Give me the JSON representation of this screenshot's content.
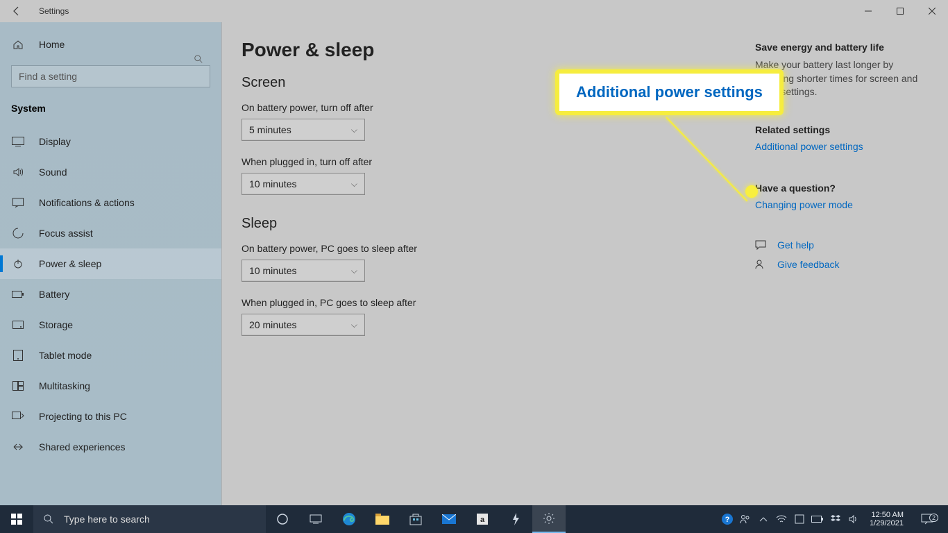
{
  "window": {
    "title": "Settings"
  },
  "sidebar": {
    "home": "Home",
    "search_placeholder": "Find a setting",
    "section": "System",
    "items": [
      {
        "label": "Display"
      },
      {
        "label": "Sound"
      },
      {
        "label": "Notifications & actions"
      },
      {
        "label": "Focus assist"
      },
      {
        "label": "Power & sleep"
      },
      {
        "label": "Battery"
      },
      {
        "label": "Storage"
      },
      {
        "label": "Tablet mode"
      },
      {
        "label": "Multitasking"
      },
      {
        "label": "Projecting to this PC"
      },
      {
        "label": "Shared experiences"
      }
    ]
  },
  "main": {
    "title": "Power & sleep",
    "sections": {
      "screen": {
        "heading": "Screen",
        "battery_label": "On battery power, turn off after",
        "battery_value": "5 minutes",
        "plugged_label": "When plugged in, turn off after",
        "plugged_value": "10 minutes"
      },
      "sleep": {
        "heading": "Sleep",
        "battery_label": "On battery power, PC goes to sleep after",
        "battery_value": "10 minutes",
        "plugged_label": "When plugged in, PC goes to sleep after",
        "plugged_value": "20 minutes"
      }
    }
  },
  "callout": {
    "text": "Additional power settings"
  },
  "aside": {
    "energy_head": "Save energy and battery life",
    "energy_text": "Make your battery last longer by choosing shorter times for screen and sleep settings.",
    "related_head": "Related settings",
    "related_link": "Additional power settings",
    "question_head": "Have a question?",
    "question_link": "Changing power mode",
    "help": "Get help",
    "feedback": "Give feedback"
  },
  "taskbar": {
    "search_placeholder": "Type here to search",
    "time": "12:50 AM",
    "date": "1/29/2021",
    "notif_count": "2"
  }
}
